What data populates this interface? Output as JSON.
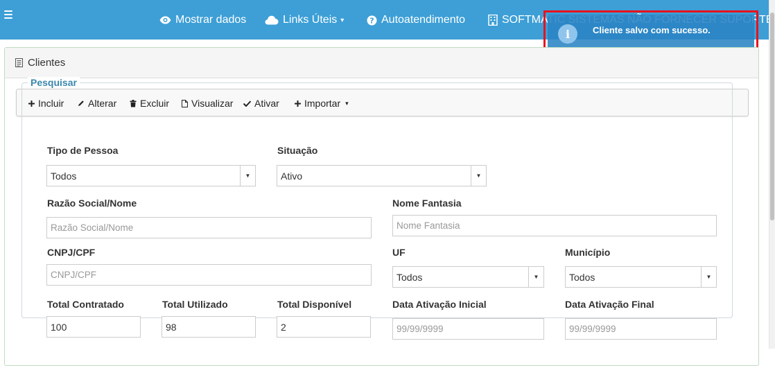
{
  "navbar": {
    "items": [
      {
        "label": "Mostrar dados",
        "icon": "eye-icon"
      },
      {
        "label": "Links Úteis",
        "icon": "cloud-icon"
      },
      {
        "label": "Autoatendimento",
        "icon": "question-circle-icon"
      },
      {
        "label": "SOFTMATIC SISTEMAS NÃO FORNECER SUPORTE",
        "icon": "building-icon"
      }
    ],
    "caret": "▾",
    "color": "#3d9fd6"
  },
  "toast": {
    "message": "Cliente salvo com sucesso.",
    "icon": "info-icon",
    "icon_glyph": "i",
    "highlight_color": "#e8121d"
  },
  "panel": {
    "title": "Clientes",
    "icon": "document-icon"
  },
  "toolbar": {
    "buttons": [
      {
        "label": "Incluir",
        "icon": "plus-icon"
      },
      {
        "label": "Alterar",
        "icon": "pencil-icon"
      },
      {
        "label": "Excluir",
        "icon": "trash-icon"
      },
      {
        "label": "Visualizar",
        "icon": "file-icon"
      },
      {
        "label": "Ativar",
        "icon": "check-icon"
      },
      {
        "label": "Importar",
        "icon": "plus-icon"
      }
    ],
    "caret": "▾"
  },
  "search": {
    "legend": "Pesquisar",
    "tipo_pessoa": {
      "label": "Tipo de Pessoa",
      "value": "Todos"
    },
    "situacao": {
      "label": "Situação",
      "value": "Ativo"
    },
    "razao_social": {
      "label": "Razão Social/Nome",
      "placeholder": "Razão Social/Nome"
    },
    "nome_fantasia": {
      "label": "Nome Fantasia",
      "placeholder": "Nome Fantasia"
    },
    "cnpj_cpf": {
      "label": "CNPJ/CPF",
      "placeholder": "CNPJ/CPF"
    },
    "uf": {
      "label": "UF",
      "value": "Todos"
    },
    "municipio": {
      "label": "Município",
      "value": "Todos"
    },
    "total_contratado": {
      "label": "Total Contratado",
      "value": "100"
    },
    "total_utilizado": {
      "label": "Total Utilizado",
      "value": "98"
    },
    "total_disponivel": {
      "label": "Total Disponível",
      "value": "2"
    },
    "data_ativacao_inicial": {
      "label": "Data Ativação Inicial",
      "placeholder": "99/99/9999"
    },
    "data_ativacao_final": {
      "label": "Data Ativação Final",
      "placeholder": "99/99/9999"
    },
    "select_arrow": "▼"
  }
}
